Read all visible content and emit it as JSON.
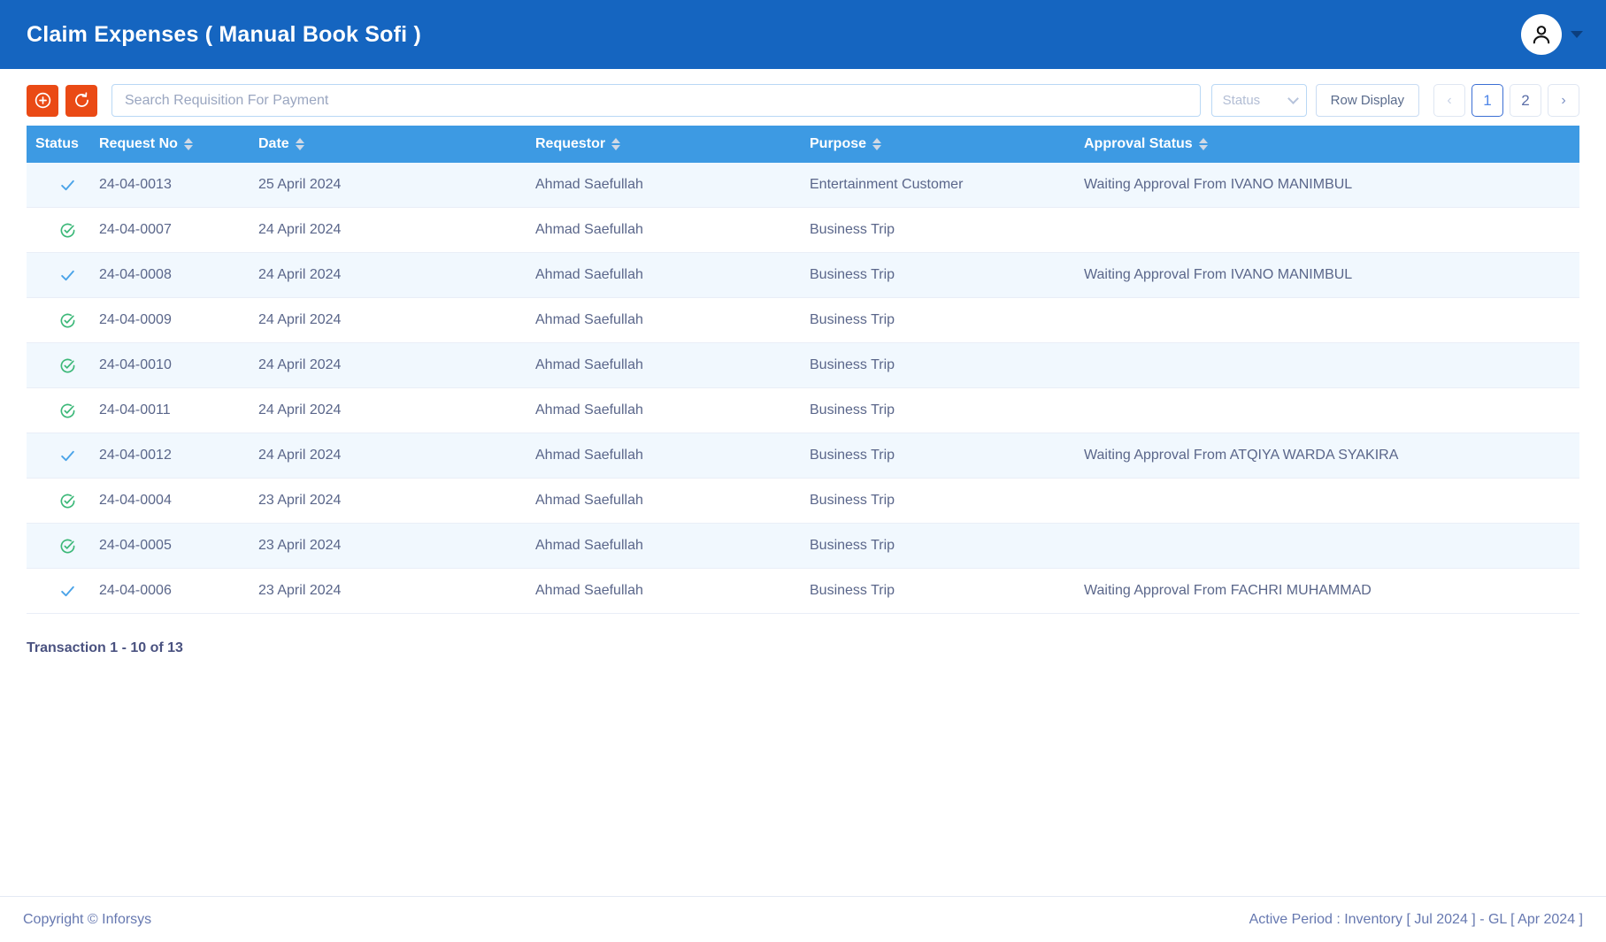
{
  "header": {
    "title": "Claim Expenses ( Manual Book Sofi )",
    "avatar_icon": "user-icon",
    "caret_icon": "chevron-down-icon",
    "bg_color": "#1565c0"
  },
  "toolbar": {
    "add_icon": "plus-circle-icon",
    "refresh_icon": "refresh-ccw-icon",
    "search_placeholder": "Search Requisition For Payment",
    "search_value": "",
    "status_filter_label": "Status",
    "status_filter_icon": "chevron-down-icon",
    "row_display_label": "Row Display",
    "pagination": {
      "prev_label": "‹",
      "next_label": "›",
      "pages": [
        "1",
        "2"
      ],
      "active_page": "1"
    },
    "accent_color": "#ea4a15"
  },
  "table": {
    "columns": [
      {
        "key": "status",
        "label": "Status",
        "sortable": false
      },
      {
        "key": "request_no",
        "label": "Request No",
        "sortable": true
      },
      {
        "key": "date",
        "label": "Date",
        "sortable": true
      },
      {
        "key": "requestor",
        "label": "Requestor",
        "sortable": true
      },
      {
        "key": "purpose",
        "label": "Purpose",
        "sortable": true
      },
      {
        "key": "approval_status",
        "label": "Approval Status",
        "sortable": true
      }
    ],
    "rows": [
      {
        "status_icon": "check-icon",
        "request_no": "24-04-0013",
        "date": "25 April 2024",
        "requestor": "Ahmad Saefullah",
        "purpose": "Entertainment Customer",
        "approval_status": "Waiting Approval From IVANO MANIMBUL"
      },
      {
        "status_icon": "check-circle-icon",
        "request_no": "24-04-0007",
        "date": "24 April 2024",
        "requestor": "Ahmad Saefullah",
        "purpose": "Business Trip",
        "approval_status": ""
      },
      {
        "status_icon": "check-icon",
        "request_no": "24-04-0008",
        "date": "24 April 2024",
        "requestor": "Ahmad Saefullah",
        "purpose": "Business Trip",
        "approval_status": "Waiting Approval From IVANO MANIMBUL"
      },
      {
        "status_icon": "check-circle-icon",
        "request_no": "24-04-0009",
        "date": "24 April 2024",
        "requestor": "Ahmad Saefullah",
        "purpose": "Business Trip",
        "approval_status": ""
      },
      {
        "status_icon": "check-circle-icon",
        "request_no": "24-04-0010",
        "date": "24 April 2024",
        "requestor": "Ahmad Saefullah",
        "purpose": "Business Trip",
        "approval_status": ""
      },
      {
        "status_icon": "check-circle-icon",
        "request_no": "24-04-0011",
        "date": "24 April 2024",
        "requestor": "Ahmad Saefullah",
        "purpose": "Business Trip",
        "approval_status": ""
      },
      {
        "status_icon": "check-icon",
        "request_no": "24-04-0012",
        "date": "24 April 2024",
        "requestor": "Ahmad Saefullah",
        "purpose": "Business Trip",
        "approval_status": "Waiting Approval From ATQIYA WARDA SYAKIRA"
      },
      {
        "status_icon": "check-circle-icon",
        "request_no": "24-04-0004",
        "date": "23 April 2024",
        "requestor": "Ahmad Saefullah",
        "purpose": "Business Trip",
        "approval_status": ""
      },
      {
        "status_icon": "check-circle-icon",
        "request_no": "24-04-0005",
        "date": "23 April 2024",
        "requestor": "Ahmad Saefullah",
        "purpose": "Business Trip",
        "approval_status": ""
      },
      {
        "status_icon": "check-icon",
        "request_no": "24-04-0006",
        "date": "23 April 2024",
        "requestor": "Ahmad Saefullah",
        "purpose": "Business Trip",
        "approval_status": "Waiting Approval From FACHRI MUHAMMAD"
      }
    ],
    "header_bg": "#3d9ae3",
    "stripe_color": "#f1f8fe",
    "status_icon_colors": {
      "check-icon": "#4aa3e8",
      "check-circle-icon": "#3bb878"
    }
  },
  "transaction_summary": "Transaction 1 - 10 of 13",
  "footer": {
    "copyright": "Copyright © Inforsys",
    "active_period": "Active Period  :  Inventory [ Jul 2024 ]  -  GL [ Apr 2024 ]"
  }
}
